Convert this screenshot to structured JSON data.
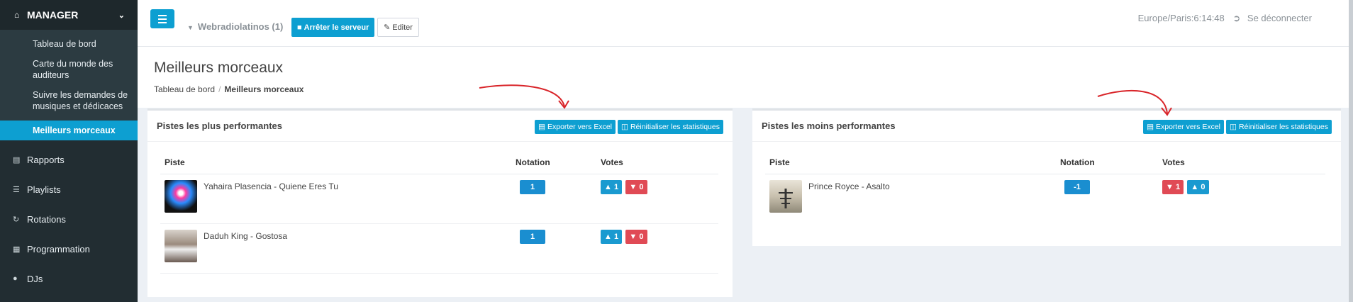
{
  "sidebar": {
    "header": "MANAGER",
    "submenu": [
      "Tableau de bord",
      "Carte du monde des auditeurs",
      "Suivre les demandes de musiques et dédicaces",
      "Meilleurs morceaux"
    ],
    "items": [
      "Rapports",
      "Playlists",
      "Rotations",
      "Programmation",
      "DJs"
    ]
  },
  "topbar": {
    "station": "Webradiolatinos (1)",
    "stop_label": "Arrêter le serveur",
    "edit_label": "Editer",
    "time": "Europe/Paris:6:14:48",
    "logout": "Se déconnecter"
  },
  "page": {
    "title": "Meilleurs morceaux",
    "breadcrumb_root": "Tableau de bord",
    "breadcrumb_current": "Meilleurs morceaux"
  },
  "top_panel": {
    "title": "Pistes les plus performantes",
    "export_label": "Exporter vers Excel",
    "reset_label": "Réinitialiser les statistiques",
    "columns": [
      "Piste",
      "Notation",
      "Votes"
    ],
    "rows": [
      {
        "track": "Yahaira Plasencia - Quiene Eres Tu",
        "rating": "1",
        "up": "1",
        "down": "0"
      },
      {
        "track": "Daduh King - Gostosa",
        "rating": "1",
        "up": "1",
        "down": "0"
      }
    ]
  },
  "bottom_panel": {
    "title": "Pistes les moins performantes",
    "export_label": "Exporter vers Excel",
    "reset_label": "Réinitialiser les statistiques",
    "columns": [
      "Piste",
      "Notation",
      "Votes"
    ],
    "rows": [
      {
        "track": "Prince Royce - Asalto",
        "rating": "-1",
        "down": "1",
        "up": "0"
      }
    ]
  },
  "colors": {
    "accent": "#0d9fd1",
    "sidebar": "#222d32",
    "thumbs_down": "#e04a55",
    "annotation": "#d9252a"
  }
}
